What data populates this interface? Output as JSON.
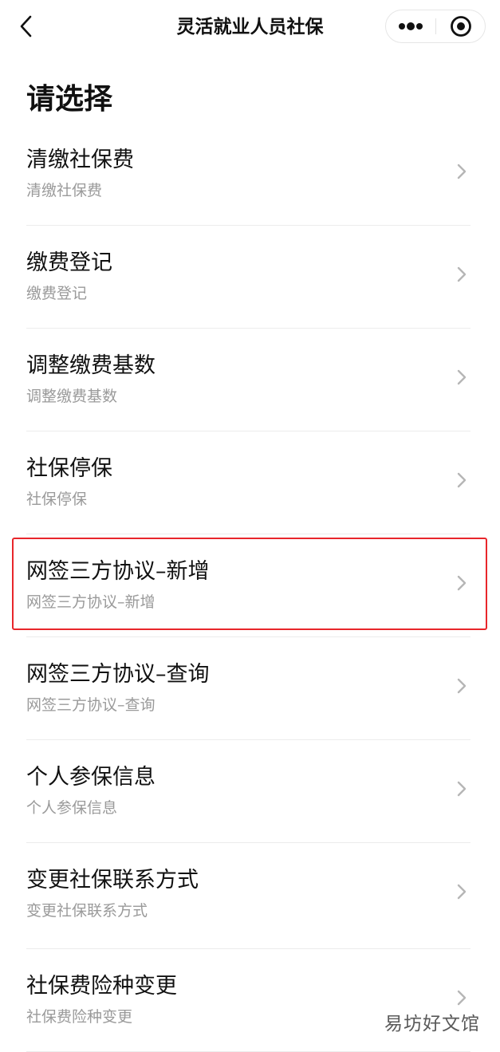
{
  "nav": {
    "title": "灵活就业人员社保",
    "back_icon": "chevron-left-icon",
    "more_icon": "more-dots-icon",
    "close_icon": "target-circle-icon"
  },
  "heading": "请选择",
  "menu": [
    {
      "title": "清缴社保费",
      "subtitle": "清缴社保费"
    },
    {
      "title": "缴费登记",
      "subtitle": "缴费登记"
    },
    {
      "title": "调整缴费基数",
      "subtitle": "调整缴费基数"
    },
    {
      "title": "社保停保",
      "subtitle": "社保停保"
    },
    {
      "title": "网签三方协议–新增",
      "subtitle": "网签三方协议–新增",
      "highlighted": true
    },
    {
      "title": "网签三方协议–查询",
      "subtitle": "网签三方协议–查询"
    },
    {
      "title": "个人参保信息",
      "subtitle": "个人参保信息"
    },
    {
      "title": "变更社保联系方式",
      "subtitle": "变更社保联系方式"
    },
    {
      "title": "社保费险种变更",
      "subtitle": "社保费险种变更"
    }
  ],
  "colors": {
    "highlight_border": "#e8262b",
    "subtitle": "#9a9a9a",
    "separator": "#ececec"
  },
  "watermark": "易坊好文馆"
}
